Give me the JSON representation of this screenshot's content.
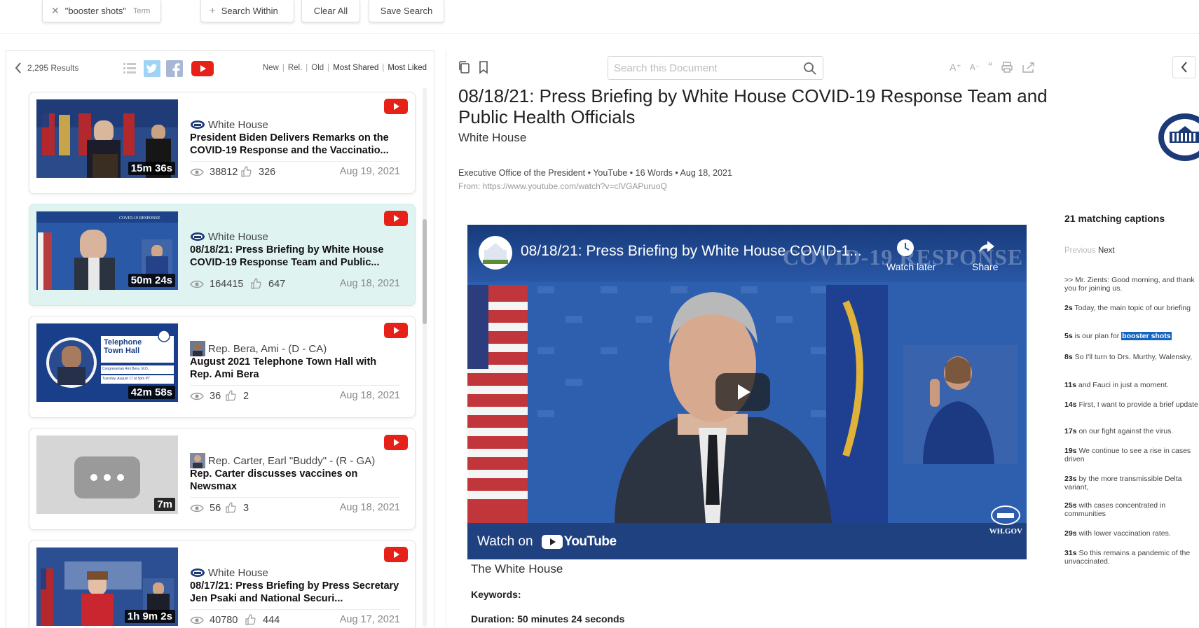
{
  "filters": {
    "term_chip": {
      "value": "\"booster shots\"",
      "type": "Term"
    },
    "search_within": "Search Within",
    "clear_all": "Clear All",
    "save_search": "Save Search"
  },
  "results_panel": {
    "count": "2,295 Results",
    "sort_options": [
      "New",
      "Rel.",
      "Old",
      "Most Shared",
      "Most Liked"
    ],
    "view_icons": [
      "list-icon",
      "twitter-icon",
      "facebook-icon",
      "youtube-icon"
    ]
  },
  "results": [
    {
      "source": "White House",
      "source_icon": "white-house-logo-icon",
      "title": "President Biden Delivers Remarks on the COVID-19 Response and the Vaccinatio...",
      "duration": "15m 36s",
      "views": "38812",
      "likes": "326",
      "date": "Aug 19, 2021",
      "active": false
    },
    {
      "source": "White House",
      "source_icon": "white-house-logo-icon",
      "title": "08/18/21: Press Briefing by White House COVID-19 Response Team and Public...",
      "duration": "50m 24s",
      "views": "164415",
      "likes": "647",
      "date": "Aug 18, 2021",
      "active": true
    },
    {
      "source": "Rep. Bera, Ami - (D - CA)",
      "source_icon": "person-photo-icon",
      "title": "August 2021 Telephone Town Hall with Rep. Ami Bera",
      "duration": "42m 58s",
      "views": "36",
      "likes": "2",
      "date": "Aug 18, 2021",
      "active": false,
      "thumb_text": [
        "Telephone",
        "Town Hall",
        "Congressman Ami Bera, M.D.",
        "Tuesday, August 17 at 5pm PT"
      ]
    },
    {
      "source": "Rep. Carter, Earl \"Buddy\" - (R - GA)",
      "source_icon": "person-photo-icon",
      "title": "Rep. Carter discusses vaccines on Newsmax",
      "duration": "7m",
      "views": "56",
      "likes": "3",
      "date": "Aug 18, 2021",
      "active": false
    },
    {
      "source": "White House",
      "source_icon": "white-house-logo-icon",
      "title": "08/17/21: Press Briefing by Press Secretary Jen Psaki and National Securi...",
      "duration": "1h 9m 2s",
      "views": "40780",
      "likes": "444",
      "date": "Aug 17, 2021",
      "active": false
    }
  ],
  "document": {
    "search_placeholder": "Search this Document",
    "title": "08/18/21: Press Briefing by White House COVID-19 Response Team and Public Health Officials",
    "source": "White House",
    "meta": "Executive Office of the President • YouTube • 16 Words • Aug 18, 2021",
    "url": "From: https://www.youtube.com/watch?v=clVGAPuruoQ",
    "video": {
      "title": "08/18/21: Press Briefing by White House COVID-1...",
      "banner": "COVID-19 RESPONSE",
      "watch_later": "Watch later",
      "share": "Share",
      "watch_on": "Watch on",
      "youtube": "YouTube",
      "wh_gov": "WH.GOV"
    },
    "channel": "The White House",
    "keywords_label": "Keywords:",
    "duration_label": "Duration: 50 minutes 24 seconds",
    "text_tools": [
      "A⁺",
      "A⁻",
      "“",
      "print-icon",
      "share-icon"
    ]
  },
  "captions": {
    "header": "21 matching captions",
    "previous": "Previous",
    "next": "Next",
    "items": [
      {
        "time": "",
        "text": ">> Mr. Zients: Good morning, and thank you for joining us."
      },
      {
        "time": "2s",
        "text": "Today, the main topic of our briefing"
      },
      {
        "time": "5s",
        "text": "is our plan for",
        "highlight": "booster shots"
      },
      {
        "time": "8s",
        "text": "So I'll turn to Drs. Murthy, Walensky,"
      },
      {
        "time": "11s",
        "text": "and Fauci in just a moment."
      },
      {
        "time": "14s",
        "text": "First, I want to provide a brief update"
      },
      {
        "time": "17s",
        "text": "on our fight against the virus."
      },
      {
        "time": "19s",
        "text": "We continue to see a rise in cases driven"
      },
      {
        "time": "23s",
        "text": "by the more transmissible Delta variant,"
      },
      {
        "time": "25s",
        "text": "with cases concentrated in communities"
      },
      {
        "time": "29s",
        "text": "with lower vaccination rates."
      },
      {
        "time": "31s",
        "text": "So this remains a pandemic of the unvaccinated."
      }
    ]
  },
  "colors": {
    "youtube_red": "#e62117",
    "active_card": "#dff4f1",
    "highlight": "#1565c0",
    "twitter": "#55acee",
    "facebook": "#3b5998"
  }
}
